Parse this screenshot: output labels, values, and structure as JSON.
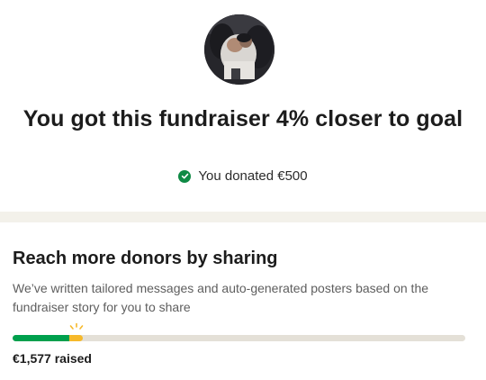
{
  "hero": {
    "headline": "You got this fundraiser 4% closer to goal",
    "donated_text": "You donated €500"
  },
  "share": {
    "title": "Reach more donors by sharing",
    "description": "We’ve written tailored messages and auto-generated posters based on the fundraiser story for you to share"
  },
  "progress": {
    "previous_fraction": 0.125,
    "contribution_fraction": 0.03,
    "raised_text": "€1,577 raised"
  },
  "colors": {
    "accent_green": "#00a04d",
    "check_green": "#0f8a45",
    "highlight_yellow": "#f6b92b",
    "track": "#e4e0d7",
    "band": "#f3f1ea"
  },
  "icons": {
    "check": "check-circle-icon",
    "spark": "sparkle-icon"
  }
}
